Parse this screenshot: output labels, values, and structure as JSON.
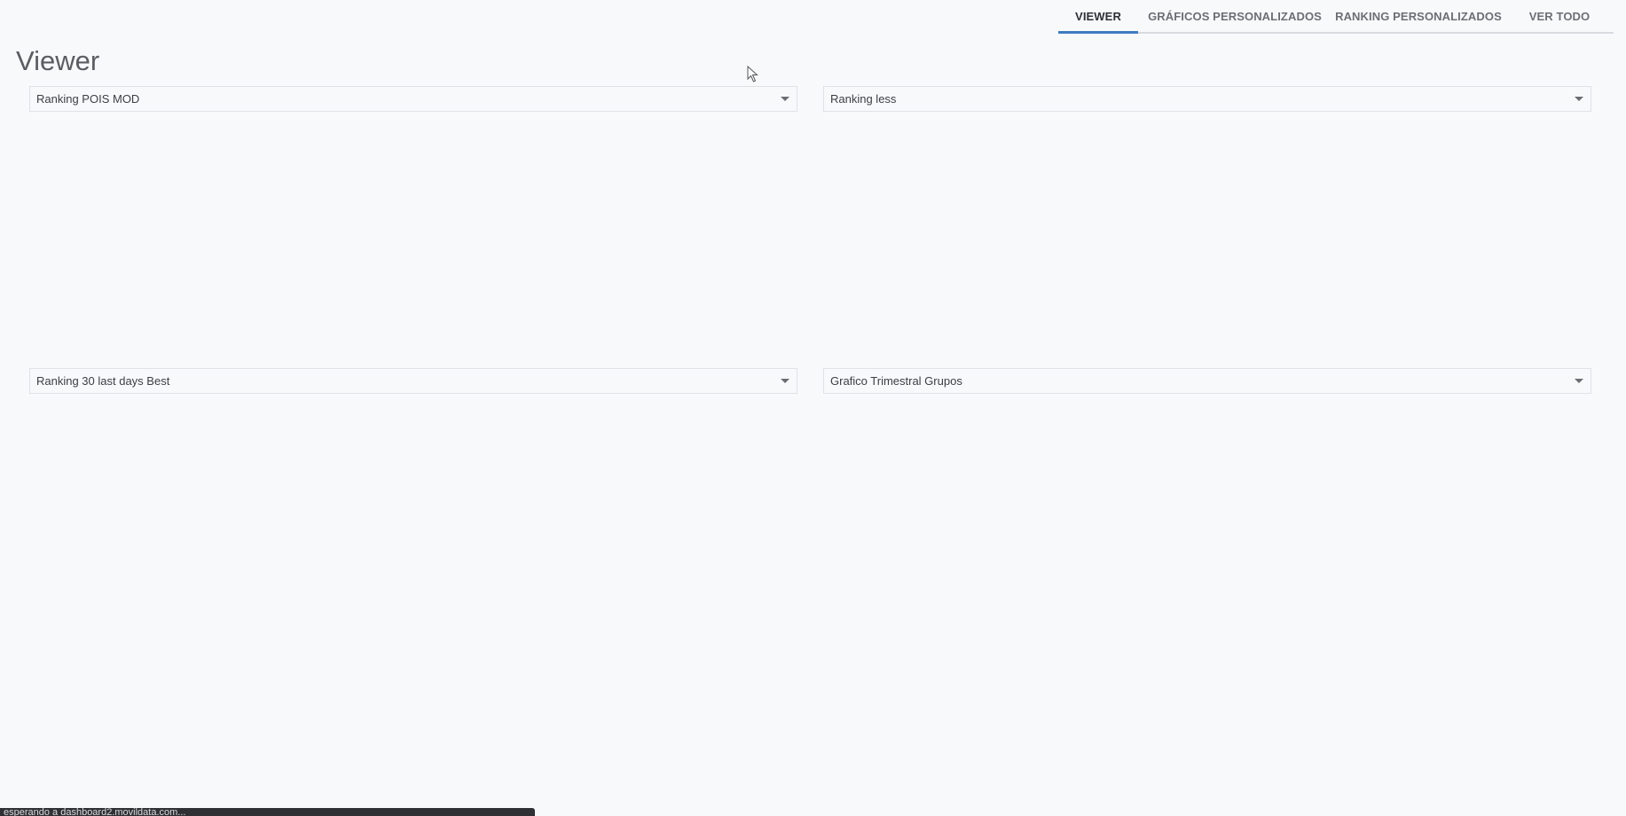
{
  "tabs": [
    {
      "label": "VIEWER",
      "active": true
    },
    {
      "label": "GRÁFICOS PERSONALIZADOS",
      "active": false
    },
    {
      "label": "RANKING PERSONALIZADOS",
      "active": false
    },
    {
      "label": "VER TODO",
      "active": false
    }
  ],
  "page": {
    "title": "Viewer"
  },
  "panels": [
    {
      "selected": "Ranking POIS MOD"
    },
    {
      "selected": "Ranking less"
    },
    {
      "selected": "Ranking 30 last days Best"
    },
    {
      "selected": "Grafico Trimestral Grupos"
    }
  ],
  "status_bar": {
    "text": "esperando a dashboard2.movildata.com..."
  },
  "colors": {
    "accent": "#3f7bbf",
    "background": "#f8f9fb",
    "tab_text": "#6b6f75"
  }
}
